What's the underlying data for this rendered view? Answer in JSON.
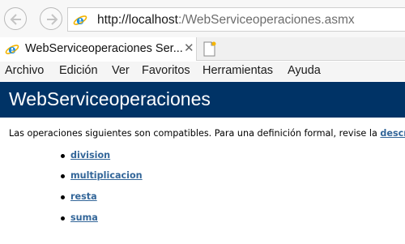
{
  "address_bar": {
    "url_prefix": "http://localhost",
    "url_rest": ":/WebServiceoperaciones.asmx"
  },
  "tab": {
    "title": "WebServiceoperaciones Ser...",
    "close_glyph": "✕"
  },
  "menu": {
    "items": [
      "Archivo",
      "Edición",
      "Ver",
      "Favoritos",
      "Herramientas",
      "Ayuda"
    ]
  },
  "page": {
    "service_name": "WebServiceoperaciones",
    "intro_text": "Las operaciones siguientes son compatibles. Para una definición formal, revise la ",
    "intro_link": "descripción de servicios",
    "operations": [
      "division",
      "multiplicacion",
      "resta",
      "suma"
    ]
  },
  "colors": {
    "banner": "#003366",
    "link": "#336699",
    "ie_logo": "#1d8ee0"
  }
}
